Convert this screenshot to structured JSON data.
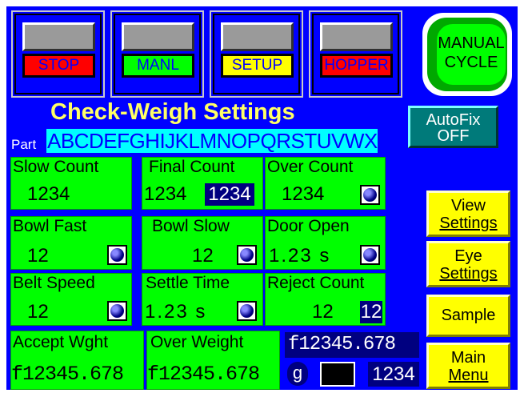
{
  "header": {
    "status_buttons": [
      {
        "label": "STOP",
        "color": "#ff0000"
      },
      {
        "label": "MANL",
        "color": "#00ff00"
      },
      {
        "label": "SETUP",
        "color": "#ffff00"
      },
      {
        "label": "HOPPER",
        "color": "#ff0000"
      }
    ],
    "manual_cycle": {
      "line1": "MANUAL",
      "line2": "CYCLE"
    }
  },
  "title": "Check-Weigh Settings",
  "autofix": {
    "line1": "AutoFix",
    "line2": "OFF"
  },
  "part": {
    "label": "Part",
    "value": "ABCDEFGHIJKLMNOPQRSTUVWXY"
  },
  "settings": {
    "slow_count": {
      "title": "Slow Count",
      "value": "1234"
    },
    "final_count": {
      "title": "Final Count",
      "value": "1234",
      "value2": "1234"
    },
    "over_count": {
      "title": "Over Count",
      "value": "1234"
    },
    "bowl_fast": {
      "title": "Bowl Fast",
      "value": "12"
    },
    "bowl_slow": {
      "title": "Bowl Slow",
      "value": "12"
    },
    "door_open": {
      "title": "Door Open",
      "value": "1.23 s"
    },
    "belt_speed": {
      "title": "Belt Speed",
      "value": "12"
    },
    "settle_time": {
      "title": "Settle Time",
      "value": "1.23 s"
    },
    "reject_count": {
      "title": "Reject Count",
      "value": "12",
      "value2": "12"
    },
    "accept_wght": {
      "title": "Accept Wght",
      "value": "f12345.678"
    },
    "over_weight": {
      "title": "Over Weight",
      "value": "f12345.678"
    }
  },
  "weight_display": {
    "value": "f12345.678",
    "unit": "g",
    "count": "1234"
  },
  "side_buttons": {
    "view_settings": {
      "line1": "View",
      "line2": "Settings"
    },
    "eye_settings": {
      "line1": "Eye",
      "line2": "Settings"
    },
    "sample": {
      "line1": "Sample"
    },
    "main_menu": {
      "line1": "Main",
      "line2": "Menu"
    }
  }
}
